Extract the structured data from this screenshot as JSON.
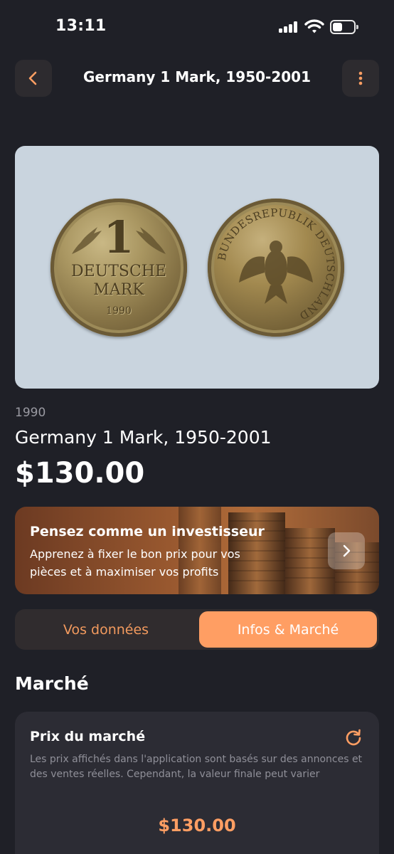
{
  "status_bar": {
    "time": "13:11"
  },
  "header": {
    "title": "Germany 1 Mark, 1950-2001"
  },
  "coin_image": {
    "front_denomination": "1",
    "front_line1": "DEUTSCHE",
    "front_line2": "MARK",
    "front_year": "1990",
    "back_inscription": "BUNDESREPUBLIK DEUTSCHLAND"
  },
  "coin": {
    "year": "1990",
    "name": "Germany 1 Mark, 1950-2001",
    "price": "$130.00"
  },
  "promo": {
    "title": "Pensez comme un investisseur",
    "text": "Apprenez à fixer le bon prix pour vos pièces et à maximiser vos profits"
  },
  "tabs": {
    "data_label": "Vos données",
    "market_label": "Infos & Marché",
    "active": "market"
  },
  "market": {
    "section_title": "Marché",
    "card_title": "Prix du marché",
    "description": "Les prix affichés dans l'application sont basés sur des annonces et des ventes réelles. Cependant, la valeur finale peut varier",
    "price": "$130.00"
  },
  "colors": {
    "background": "#1f2027",
    "accent": "#ff9e63",
    "card": "#2c2c34",
    "image_background": "#c9d4de"
  },
  "icons": {
    "back": "chevron-left-icon",
    "more": "more-vertical-icon",
    "promo_arrow": "chevron-right-icon",
    "refresh": "refresh-icon"
  }
}
